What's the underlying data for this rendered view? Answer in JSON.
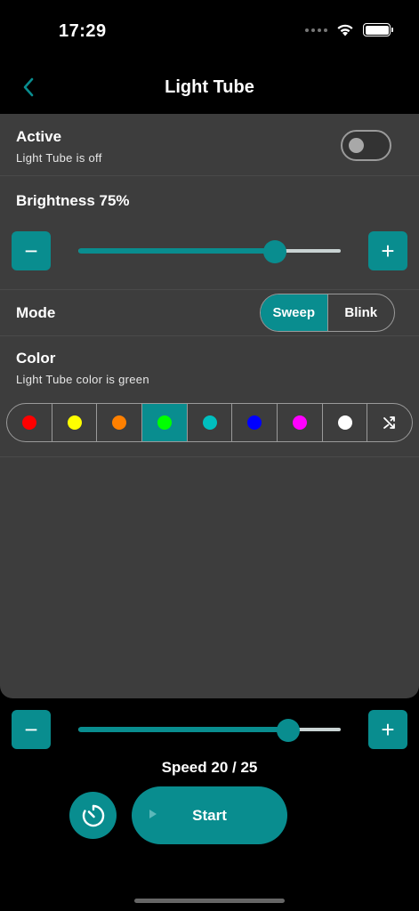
{
  "status": {
    "time": "17:29"
  },
  "nav": {
    "title": "Light Tube"
  },
  "active": {
    "title": "Active",
    "subtitle": "Light Tube is off",
    "on": false
  },
  "brightness": {
    "label": "Brightness 75%",
    "value": 75,
    "minus": "−",
    "plus": "+"
  },
  "mode": {
    "title": "Mode",
    "options": [
      "Sweep",
      "Blink"
    ],
    "selected": "Sweep"
  },
  "color": {
    "title": "Color",
    "subtitle": "Light Tube color is green",
    "swatches": [
      {
        "name": "red",
        "hex": "#ff0000"
      },
      {
        "name": "yellow",
        "hex": "#ffff00"
      },
      {
        "name": "orange",
        "hex": "#ff8000"
      },
      {
        "name": "green",
        "hex": "#00ff00"
      },
      {
        "name": "cyan",
        "hex": "#00bfbf"
      },
      {
        "name": "blue",
        "hex": "#0000ff"
      },
      {
        "name": "magenta",
        "hex": "#ff00ff"
      },
      {
        "name": "white",
        "hex": "#ffffff"
      },
      {
        "name": "random",
        "icon": "shuffle-icon"
      }
    ],
    "selected": "green"
  },
  "speed": {
    "label": "Speed 20 / 25",
    "value": 20,
    "max": 25,
    "minus": "−",
    "plus": "+"
  },
  "controls": {
    "start_label": "Start",
    "timer_icon": "timer-icon"
  },
  "theme": {
    "accent": "#098d8f",
    "panel": "#3d3d3d",
    "background": "#000000"
  }
}
